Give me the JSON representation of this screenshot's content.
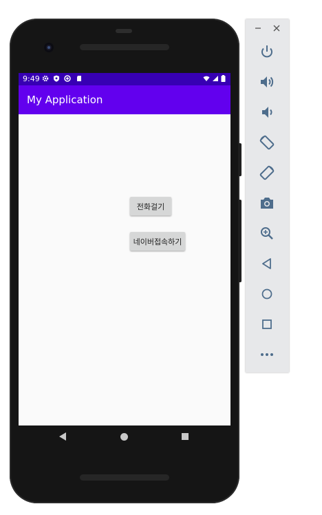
{
  "status_bar": {
    "time": "9:49"
  },
  "app": {
    "title": "My Application"
  },
  "buttons": {
    "call": "전화걸기",
    "naver": "네이버접속하기"
  },
  "colors": {
    "primary": "#6200ee",
    "primary_dark": "#3700b3",
    "screen_bg": "#fafafa",
    "button_bg": "#d6d7d7"
  },
  "emulator_panel": {
    "tools": [
      "power-icon",
      "volume-up-icon",
      "volume-down-icon",
      "rotate-left-icon",
      "rotate-right-icon",
      "camera-icon",
      "zoom-icon",
      "back-icon",
      "home-icon",
      "overview-icon",
      "more-icon"
    ]
  }
}
